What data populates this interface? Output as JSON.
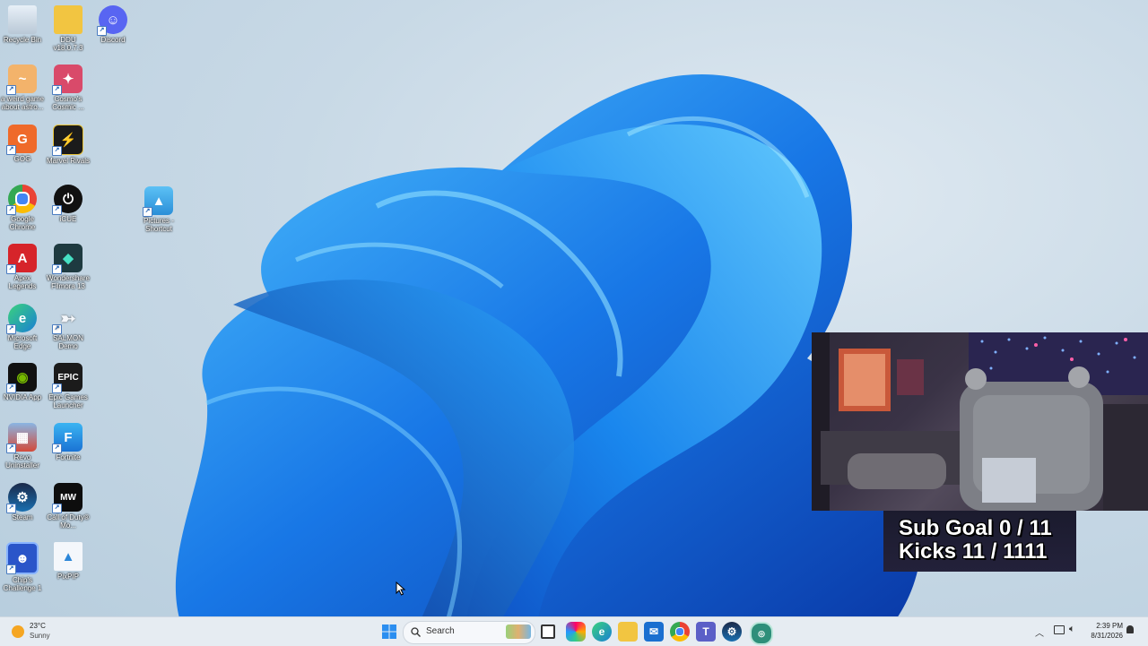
{
  "desktop": {
    "icons": [
      {
        "label": "Recycle Bin",
        "icon": "recycle-bin-icon"
      },
      {
        "label": "DDU v18.0.7.3",
        "icon": "folder-icon"
      },
      {
        "label": "Discord",
        "icon": "discord-icon"
      },
      {
        "label": "a weird game about astro...",
        "icon": "game-icon"
      },
      {
        "label": "Cosmo's Cosmic ...",
        "icon": "game-icon"
      },
      {
        "label": "GOG",
        "icon": "gog-icon"
      },
      {
        "label": "Marvel Rivals",
        "icon": "marvel-rivals-icon"
      },
      {
        "label": "Google Chrome",
        "icon": "chrome-icon"
      },
      {
        "label": "iCUE",
        "icon": "icue-icon"
      },
      {
        "label": "Pictures - Shortcut",
        "icon": "pictures-icon"
      },
      {
        "label": "Apex Legends",
        "icon": "apex-icon"
      },
      {
        "label": "Wondershare Filmora 13",
        "icon": "filmora-icon"
      },
      {
        "label": "Microsoft Edge",
        "icon": "edge-icon"
      },
      {
        "label": "SALMON Demo",
        "icon": "fish-icon"
      },
      {
        "label": "NVIDIA App",
        "icon": "nvidia-icon"
      },
      {
        "label": "Epic Games Launcher",
        "icon": "epic-icon"
      },
      {
        "label": "Revo Uninstaller",
        "icon": "revo-icon"
      },
      {
        "label": "Fortnite",
        "icon": "fortnite-icon"
      },
      {
        "label": "Steam",
        "icon": "steam-icon"
      },
      {
        "label": "Call of Duty® Mo...",
        "icon": "cod-icon"
      },
      {
        "label": "Chip's Challenge 1",
        "icon": "chips-challenge-icon"
      },
      {
        "label": "PixPIP",
        "icon": "image-file-icon"
      }
    ]
  },
  "stream_overlay": {
    "sub_goal": "Sub Goal 0 / 11",
    "kicks": "Kicks 11 / 1111"
  },
  "taskbar": {
    "weather": {
      "temp": "23°C",
      "condition": "Sunny"
    },
    "search_placeholder": "Search",
    "clock": {
      "time": "2:39 PM",
      "date": "8/31/2026"
    }
  }
}
